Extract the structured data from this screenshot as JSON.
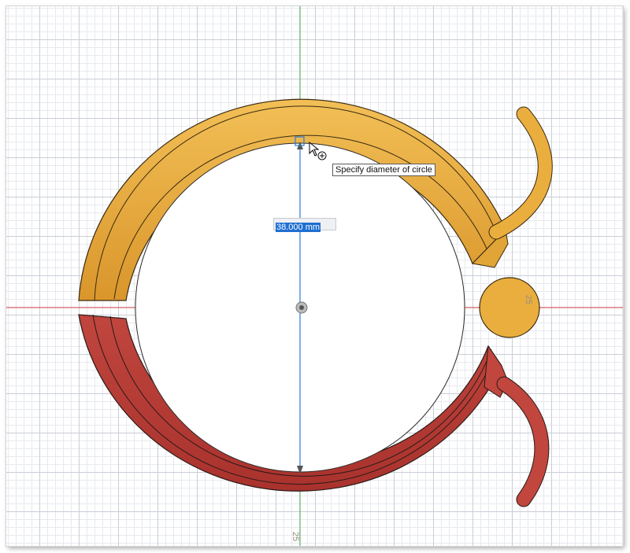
{
  "sketch": {
    "dimension_value": "38.000 mm",
    "tooltip": "Specify diameter of circle",
    "ruler_tick_right": "25",
    "ruler_tick_bottom": "25"
  },
  "colors": {
    "top_body": "#e9ad3c",
    "bottom_body": "#c2473f",
    "x_axis": "#d7424b",
    "y_axis": "#4aa64f",
    "sketch_line": "#2c7bd6"
  },
  "icons": [
    "origin-point-icon",
    "mouse-cursor-icon",
    "snap-target-icon"
  ]
}
